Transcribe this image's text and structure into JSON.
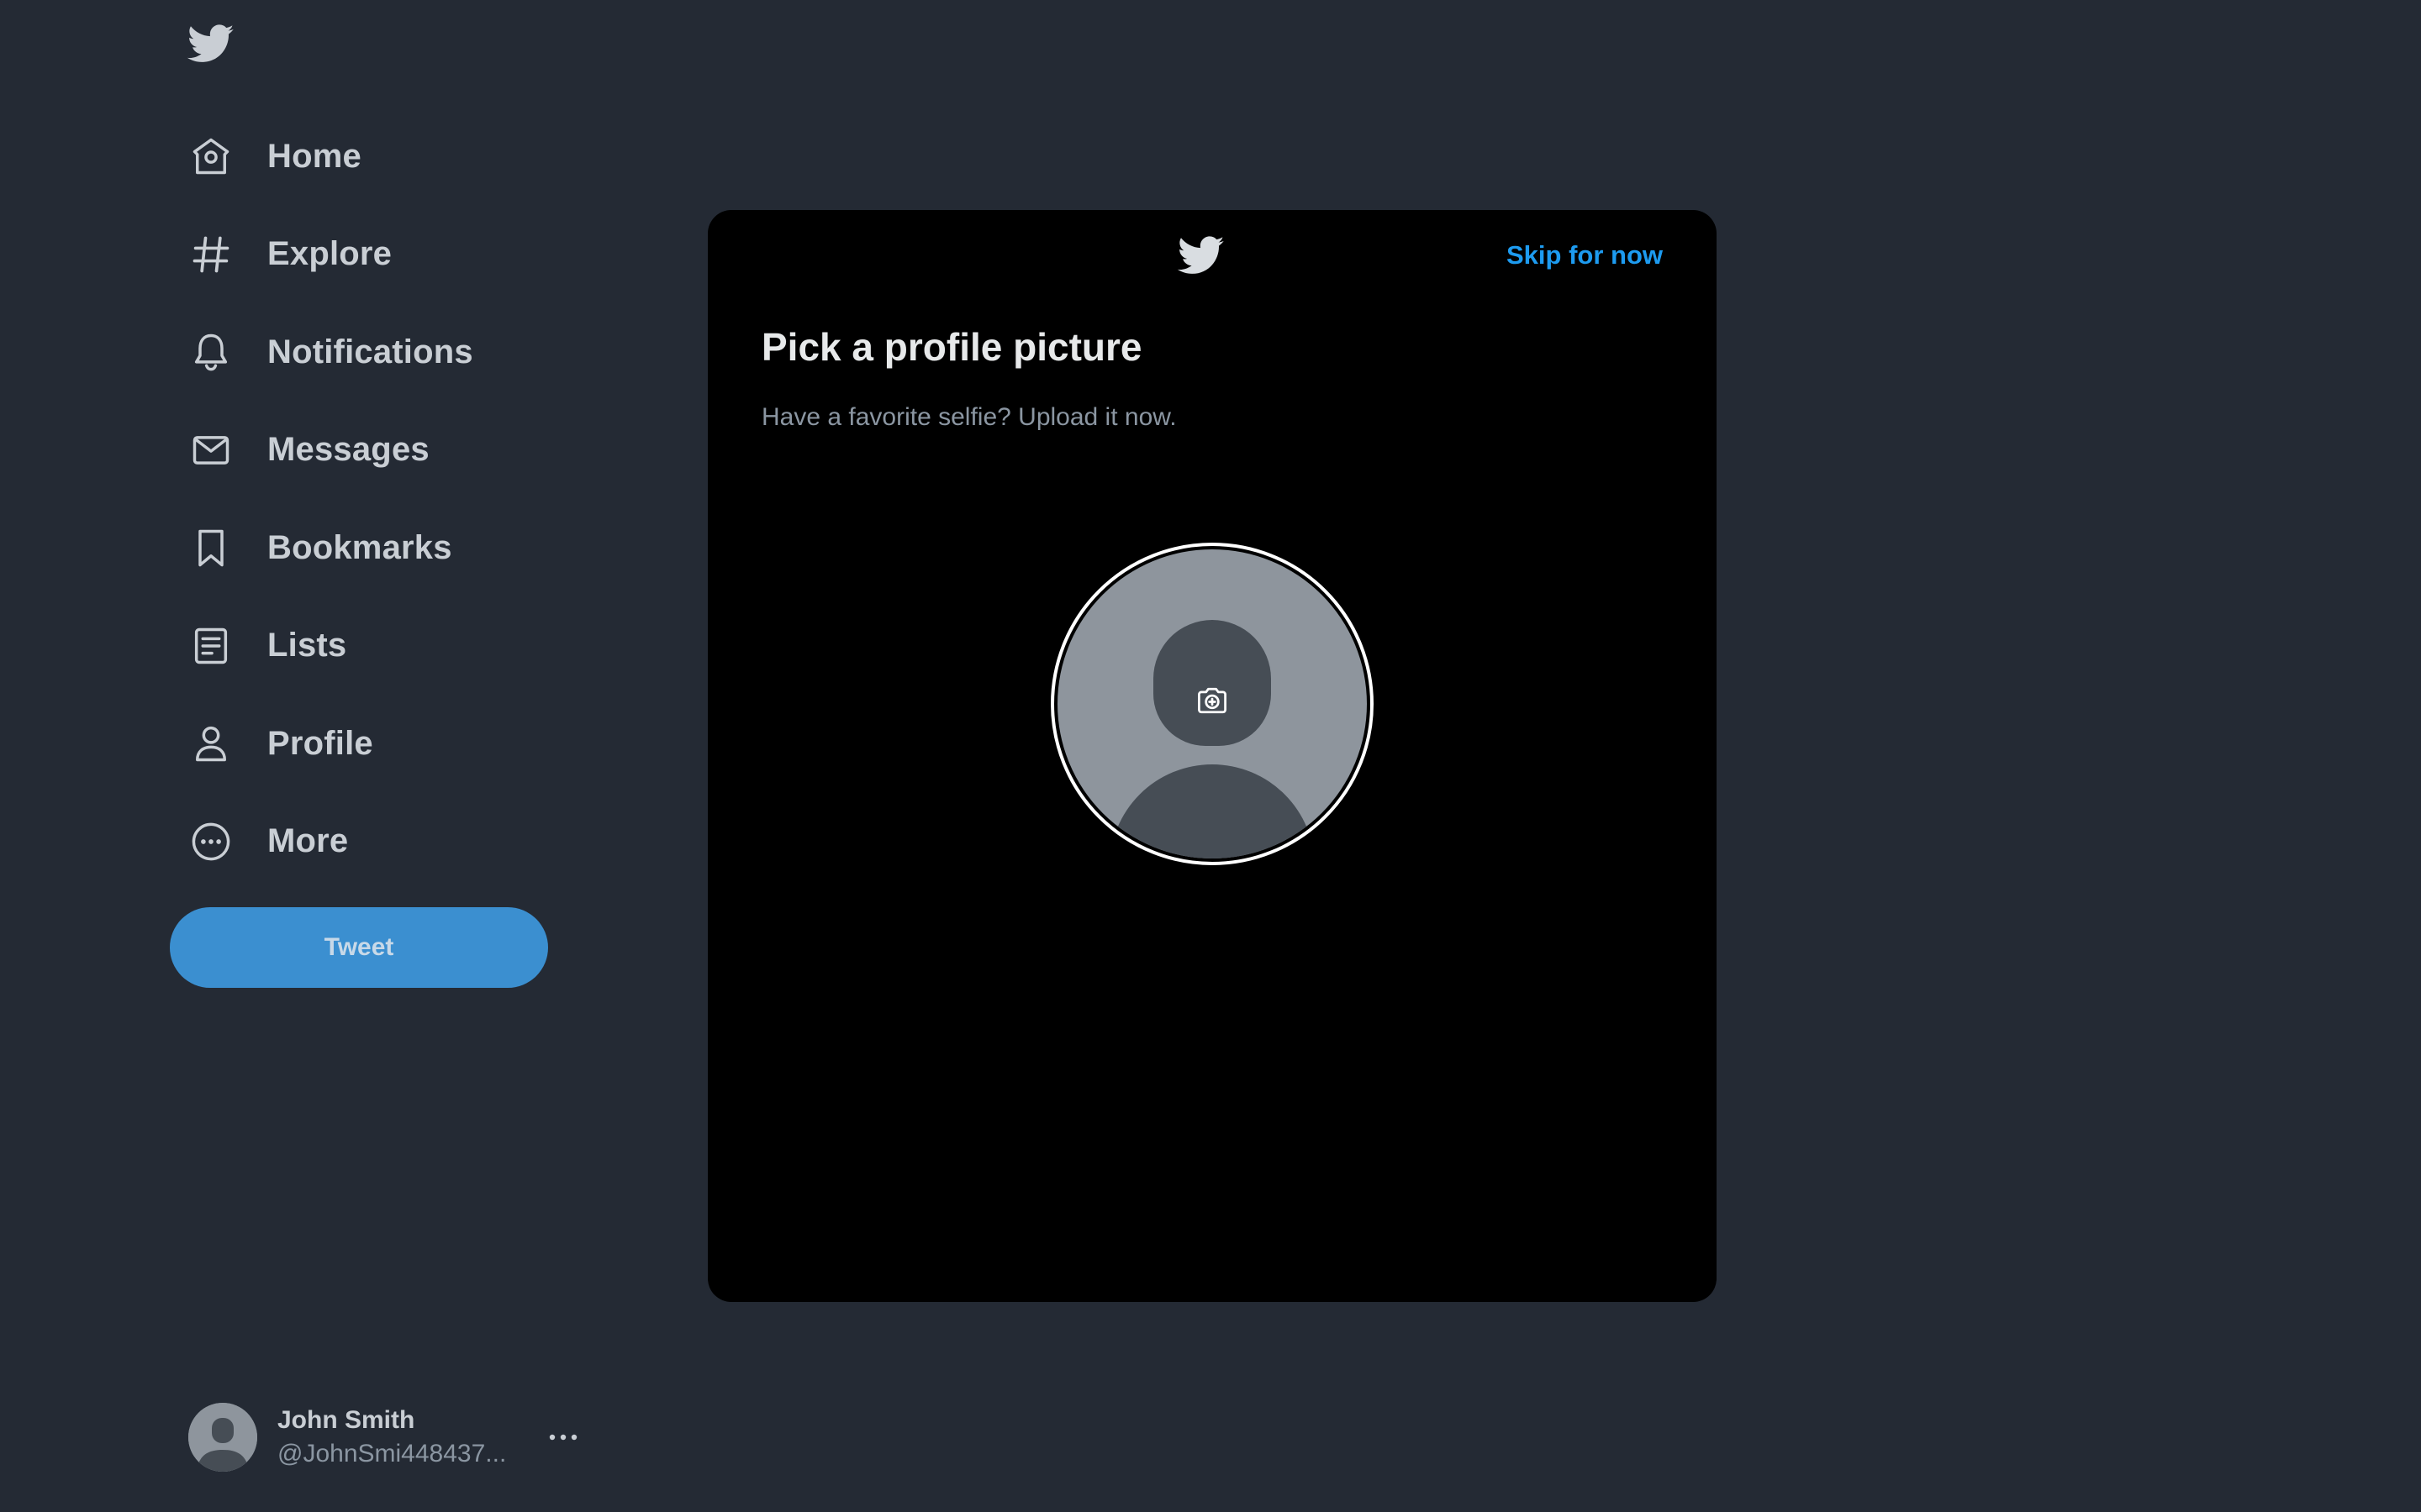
{
  "sidebar": {
    "logo_icon": "twitter-bird-icon",
    "items": [
      {
        "label": "Home",
        "icon": "home-icon"
      },
      {
        "label": "Explore",
        "icon": "hashtag-icon"
      },
      {
        "label": "Notifications",
        "icon": "bell-icon"
      },
      {
        "label": "Messages",
        "icon": "envelope-icon"
      },
      {
        "label": "Bookmarks",
        "icon": "bookmark-icon"
      },
      {
        "label": "Lists",
        "icon": "list-icon"
      },
      {
        "label": "Profile",
        "icon": "person-icon"
      },
      {
        "label": "More",
        "icon": "more-circle-icon"
      }
    ],
    "tweet_button": "Tweet",
    "account": {
      "name": "John Smith",
      "handle": "@JohnSmi448437...",
      "more_icon": "ellipsis-icon"
    }
  },
  "modal": {
    "logo_icon": "twitter-bird-icon",
    "skip_label": "Skip for now",
    "title": "Pick a profile picture",
    "subtitle": "Have a favorite selfie? Upload it now.",
    "upload_icon": "add-photo-camera-icon"
  },
  "colors": {
    "background": "#242a34",
    "modal_background": "#000000",
    "accent": "#1d9bf0",
    "tweet_button": "#3b8fd0",
    "nav_text": "#c9ced4",
    "muted_text": "#8b96a2",
    "avatar_bg": "#8e959d",
    "avatar_silhouette": "#464d55"
  }
}
